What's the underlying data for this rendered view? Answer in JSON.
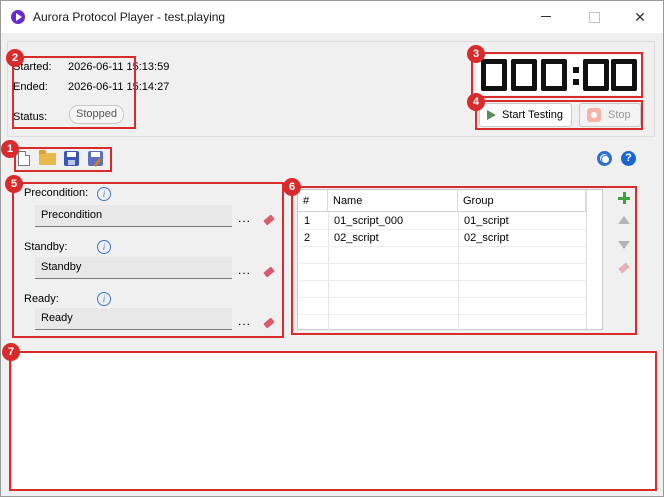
{
  "window": {
    "title": "Aurora Protocol Player - test.playing",
    "minimize_label": "—",
    "maximize_label": "☐",
    "close_label": "✕"
  },
  "session": {
    "started_label": "Started:",
    "started_value": "2026-06-11 15:13:59",
    "ended_label": "Ended:",
    "ended_value": "2026-06-11 15:14:27",
    "status_label": "Status:",
    "status_value": "Stopped"
  },
  "timer": {
    "display": "000:00"
  },
  "controls": {
    "start_label": "Start Testing",
    "stop_label": "Stop"
  },
  "toolbar": {
    "icons": [
      "new-file-icon",
      "open-folder-icon",
      "save-icon",
      "save-as-icon"
    ],
    "right_icons": [
      "settings-gear-icon",
      "help-icon"
    ],
    "help_glyph": "?"
  },
  "scripts": {
    "precondition_label": "Precondition:",
    "precondition_value": "Precondition",
    "standby_label": "Standby:",
    "standby_value": "Standby",
    "ready_label": "Ready:",
    "ready_value": "Ready",
    "browse_label": "...",
    "info_glyph": "i"
  },
  "table": {
    "columns": [
      "#",
      "Name",
      "Group"
    ],
    "rows": [
      {
        "index": "1",
        "name": "01_script_000",
        "group": "01_script"
      },
      {
        "index": "2",
        "name": "02_script",
        "group": "02_script"
      }
    ]
  },
  "annotations": [
    "1",
    "2",
    "3",
    "4",
    "5",
    "6",
    "7"
  ],
  "colors": {
    "accent": "#6a2ad1",
    "annotation": "#d92b2b",
    "help": "#1a66d1",
    "add": "#3fa23f"
  }
}
